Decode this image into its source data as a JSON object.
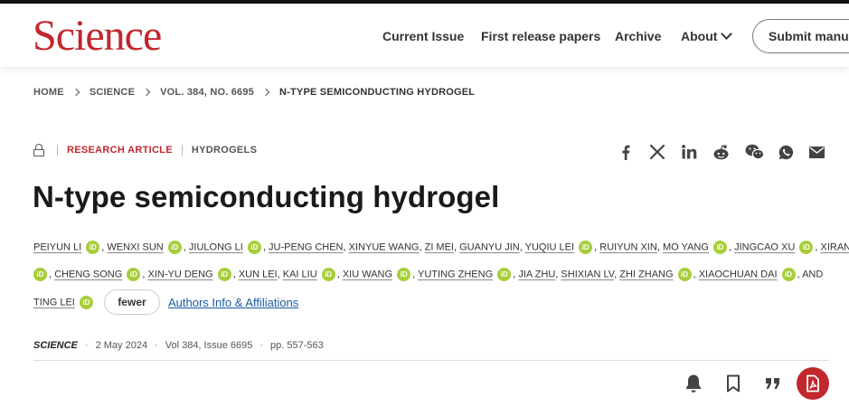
{
  "brand": {
    "logo": "Science",
    "accent": "#c1272d"
  },
  "nav": {
    "current_issue": "Current Issue",
    "first_release": "First release papers",
    "archive": "Archive",
    "about": "About",
    "submit": "Submit manus"
  },
  "breadcrumb": [
    "HOME",
    "SCIENCE",
    "VOL. 384, NO. 6695",
    "N-TYPE SEMICONDUCTING HYDROGEL"
  ],
  "article": {
    "type": "RESEARCH ARTICLE",
    "topic": "HYDROGELS",
    "title": "N-type semiconducting hydrogel"
  },
  "share_icons": [
    "facebook-icon",
    "x-icon",
    "linkedin-icon",
    "reddit-icon",
    "wechat-icon",
    "whatsapp-icon",
    "email-icon"
  ],
  "authors": {
    "line1": [
      "PEIYUN LI",
      "WENXI SUN",
      "JIULONG LI",
      "JU-PENG CHEN",
      "XINYUE WANG",
      "ZI MEI",
      "GUANYU JIN",
      "YUQIU LEI",
      "RUIYUN XIN",
      "MO YANG",
      "JINGCAO XU",
      "XIRAN PAN"
    ],
    "line2": [
      "CHENG SONG",
      "XIN-YU DENG",
      "XUN LEI",
      "KAI LIU",
      "XIU WANG",
      "YUTING ZHENG",
      "JIA ZHU",
      "SHIXIAN LV",
      "ZHI ZHANG",
      "XIAOCHUAN DAI"
    ],
    "and": "AND",
    "line3": [
      "TING LEI"
    ],
    "orcid_label": "iD",
    "fewer": "fewer",
    "affiliations": "Authors Info & Affiliations"
  },
  "publication": {
    "journal": "SCIENCE",
    "date": "2 May 2024",
    "volume": "Vol 384, Issue 6695",
    "pages": "pp. 557-563"
  },
  "tools": [
    "alert-bell-icon",
    "bookmark-icon",
    "cite-icon",
    "pdf-icon"
  ]
}
